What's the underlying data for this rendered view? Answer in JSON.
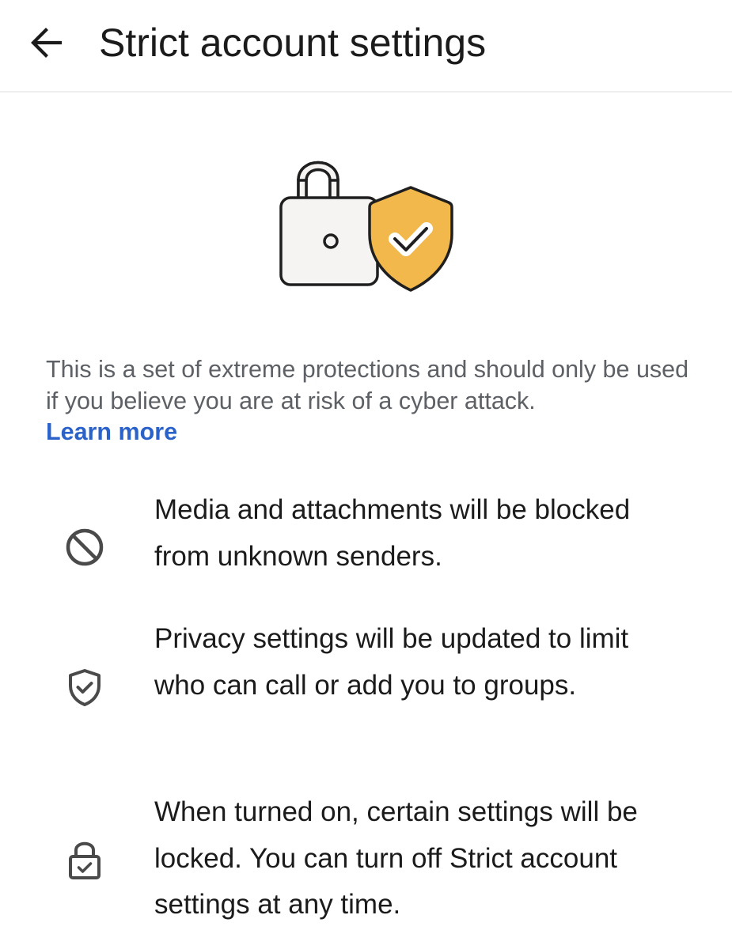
{
  "header": {
    "title": "Strict account settings",
    "back_icon": "arrow-back-icon"
  },
  "hero": {
    "icons": [
      "lock-icon",
      "shield-check-icon"
    ],
    "accent_color": "#F2B84B"
  },
  "intro": {
    "text": "This is a set of extreme protections and should only be used if you believe you are at risk of a cyber attack.",
    "link_label": "Learn more",
    "link_color": "#2A62C9"
  },
  "features": [
    {
      "icon": "block-icon",
      "text": "Media and attachments will be blocked from unknown senders."
    },
    {
      "icon": "shield-check-icon",
      "text": "Privacy settings will be updated to limit who can call or add you to groups."
    },
    {
      "icon": "lock-check-icon",
      "text": "When turned on, certain settings will be locked. You can turn off Strict account settings at any time."
    }
  ]
}
